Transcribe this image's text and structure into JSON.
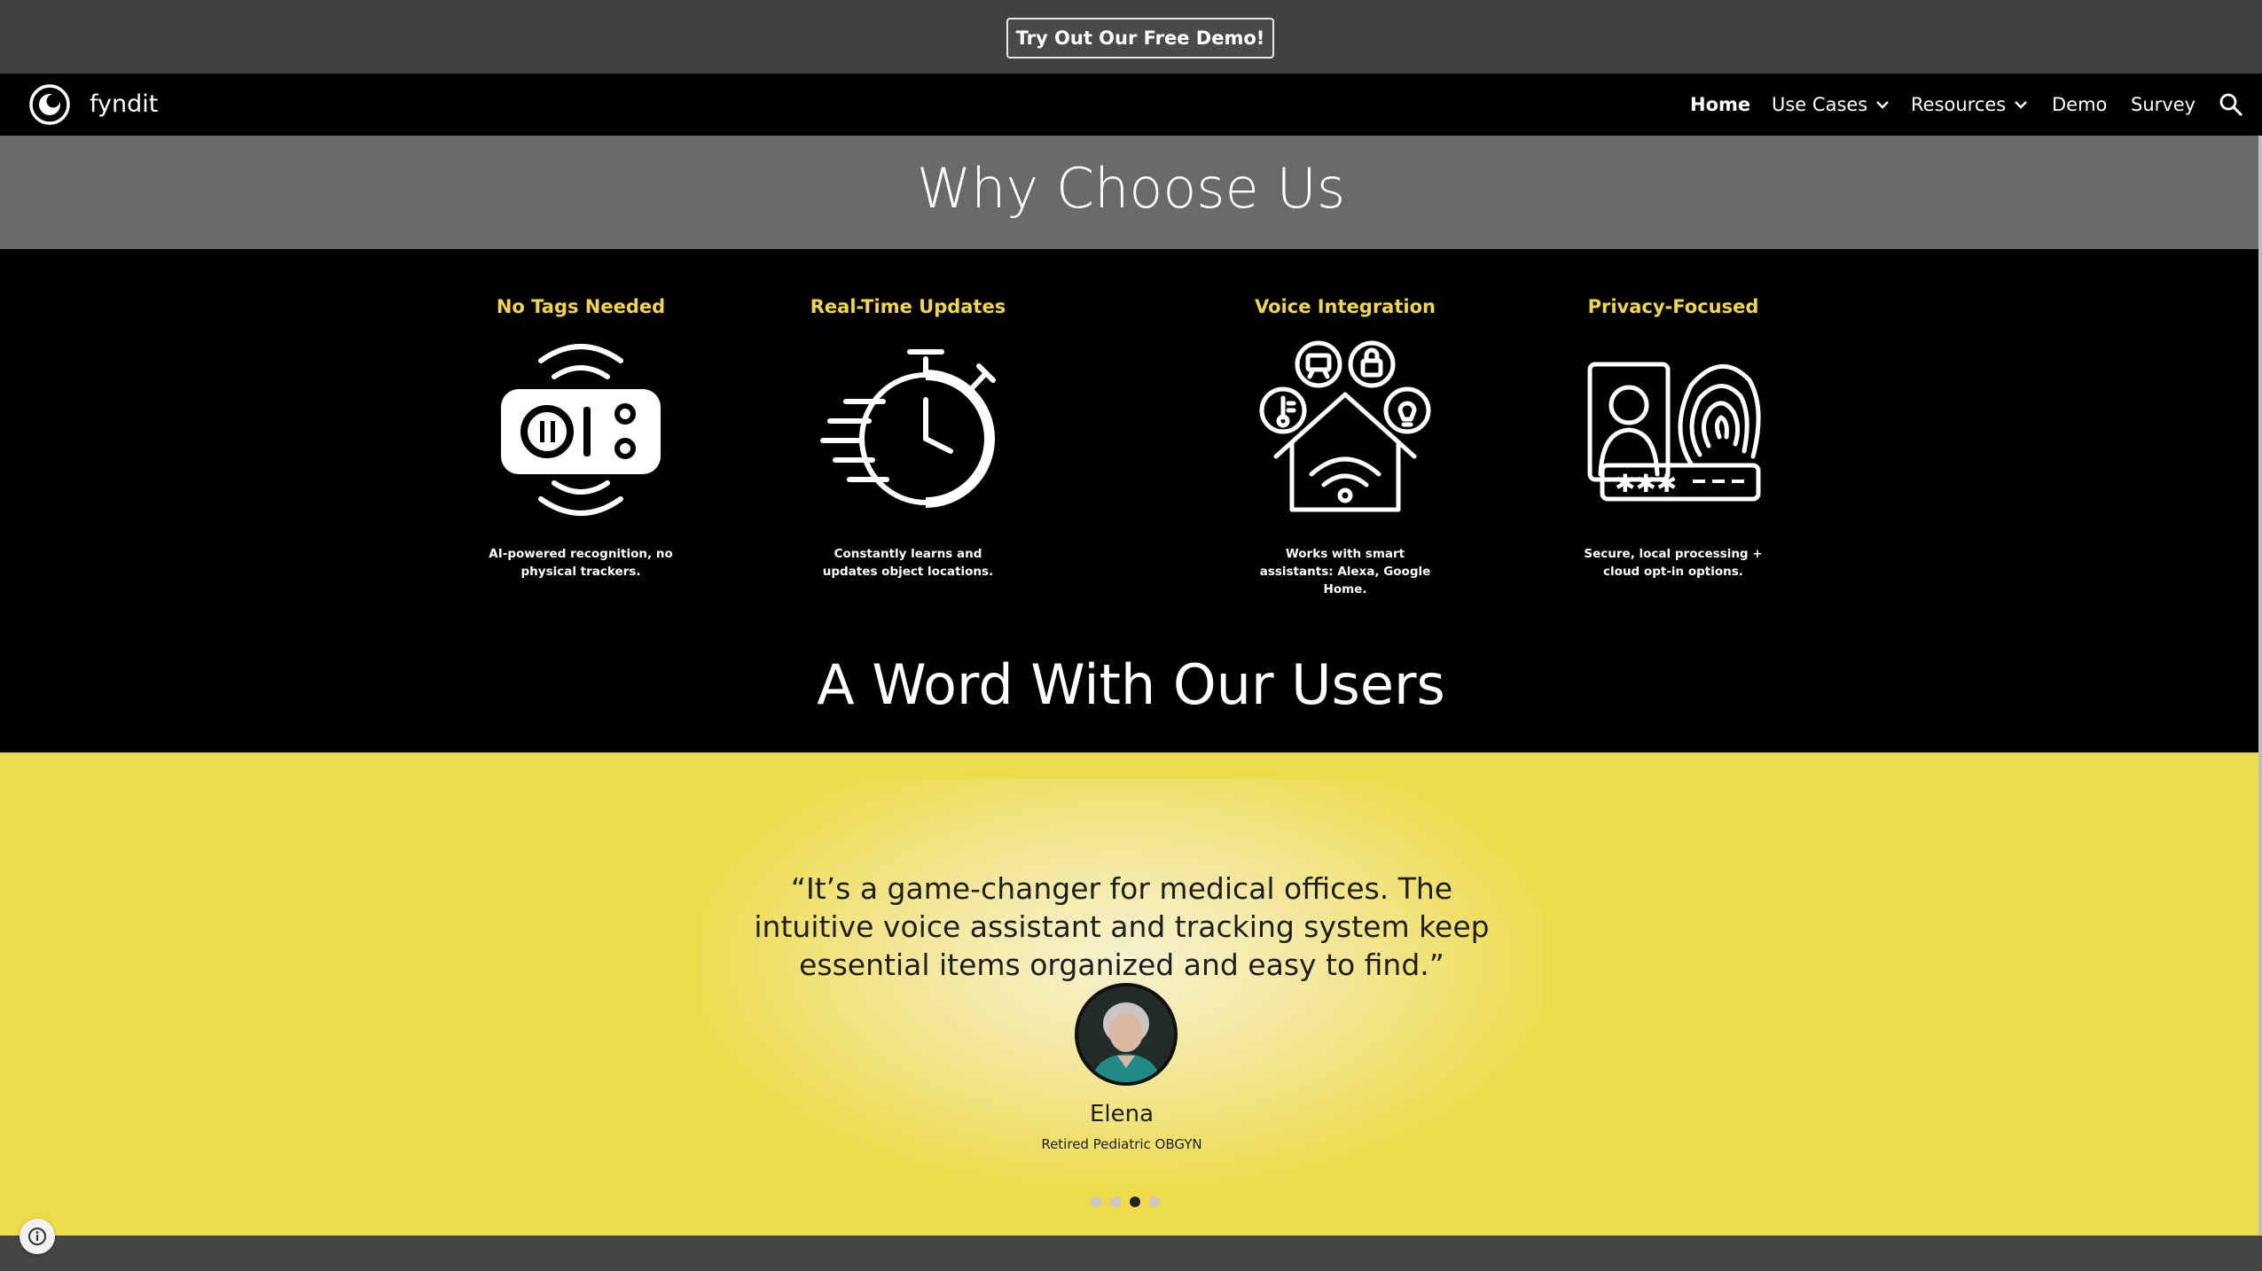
{
  "promo": {
    "button_label": "Try Out Our Free Demo!"
  },
  "nav": {
    "brand": "fyndit",
    "items": [
      {
        "label": "Home",
        "active": true
      },
      {
        "label": "Use Cases",
        "dropdown": true
      },
      {
        "label": "Resources",
        "dropdown": true
      },
      {
        "label": "Demo"
      },
      {
        "label": "Survey"
      }
    ]
  },
  "why": {
    "title": "Why Choose Us",
    "features": [
      {
        "title": "No Tags Needed",
        "desc": "AI-powered recognition, no physical trackers.",
        "icon": "scanner-icon"
      },
      {
        "title": "Real-Time Updates",
        "desc": "Constantly learns and updates object locations.",
        "icon": "stopwatch-icon"
      },
      {
        "title": "Voice Integration",
        "desc": "Works with smart assistants: Alexa, Google Home.",
        "icon": "smart-home-icon"
      },
      {
        "title": "Privacy-Focused",
        "desc": "Secure, local processing + cloud opt-in options.",
        "icon": "fingerprint-icon"
      }
    ]
  },
  "users": {
    "title": "A Word With Our Users",
    "testimonial": {
      "quote": "“It’s a game-changer for medical offices. The intuitive voice assistant and tracking system keep essential items organized and easy to find.”",
      "name": "Elena",
      "role": "Retired Pediatric OBGYN"
    },
    "carousel": {
      "count": 4,
      "active_index": 2
    }
  },
  "colors": {
    "accent": "#f2d64a",
    "band_yellow": "#eedb4b",
    "nav_bg": "#000000"
  }
}
